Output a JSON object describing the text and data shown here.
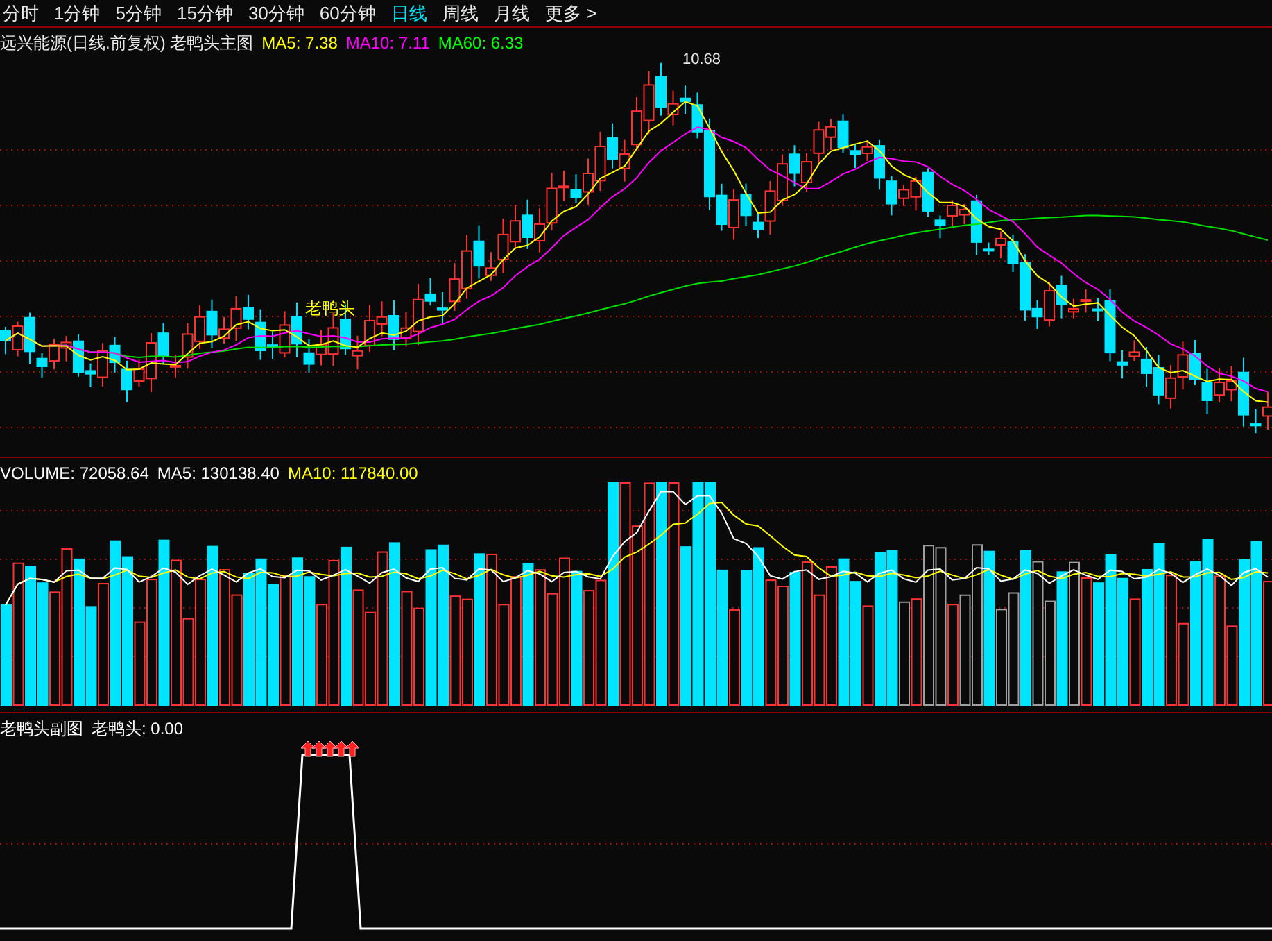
{
  "periods": [
    {
      "label": "分时",
      "selected": false
    },
    {
      "label": "1分钟",
      "selected": false
    },
    {
      "label": "5分钟",
      "selected": false
    },
    {
      "label": "15分钟",
      "selected": false
    },
    {
      "label": "30分钟",
      "selected": false
    },
    {
      "label": "60分钟",
      "selected": false
    },
    {
      "label": "日线",
      "selected": true
    },
    {
      "label": "周线",
      "selected": false
    },
    {
      "label": "月线",
      "selected": false
    },
    {
      "label": "更多 >",
      "selected": false
    }
  ],
  "main_chart": {
    "title": "远兴能源(日线.前复权) 老鸭头主图",
    "legend": [
      {
        "label": "MA5: 7.38",
        "color": "#ffff00"
      },
      {
        "label": "MA10: 7.11",
        "color": "#ff00ff"
      },
      {
        "label": "MA60: 6.33",
        "color": "#00ff00"
      }
    ],
    "high_label": "10.68",
    "signal_label": "老鸭头"
  },
  "volume_chart": {
    "legend": [
      {
        "label": "VOLUME: 72058.64",
        "color": "#ffffff"
      },
      {
        "label": "MA5: 130138.40",
        "color": "#ffffff"
      },
      {
        "label": "MA10: 117840.00",
        "color": "#ffff00"
      }
    ]
  },
  "sub_chart": {
    "title": "老鸭头副图",
    "value": "老鸭头: 0.00"
  }
}
